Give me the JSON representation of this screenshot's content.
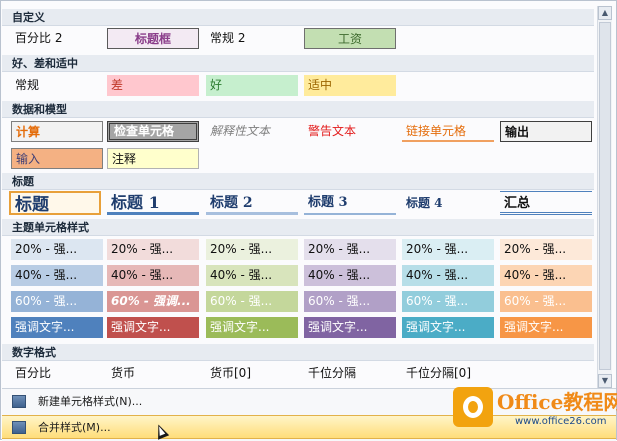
{
  "sections": {
    "custom": "自定义",
    "good_bad": "好、差和适中",
    "data_model": "数据和模型",
    "titles": "标题",
    "theme": "主题单元格样式",
    "number": "数字格式"
  },
  "custom": [
    "百分比 2",
    "标题框",
    "常规 2",
    "工资"
  ],
  "good_bad": [
    "常规",
    "差",
    "好",
    "适中"
  ],
  "data_model": [
    "计算",
    "检查单元格",
    "解释性文本",
    "警告文本",
    "链接单元格",
    "输出",
    "输入",
    "注释"
  ],
  "titles": [
    "标题",
    "标题 1",
    "标题 2",
    "标题 3",
    "标题 4",
    "汇总"
  ],
  "theme_rows": [
    [
      "20% - 强...",
      "20% - 强...",
      "20% - 强...",
      "20% - 强...",
      "20% - 强...",
      "20% - 强..."
    ],
    [
      "40% - 强...",
      "40% - 强...",
      "40% - 强...",
      "40% - 强...",
      "40% - 强...",
      "40% - 强..."
    ],
    [
      "60% - 强...",
      "60% - 强调...",
      "60% - 强...",
      "60% - 强...",
      "60% - 强...",
      "60% - 强..."
    ],
    [
      "强调文字...",
      "强调文字...",
      "强调文字...",
      "强调文字...",
      "强调文字...",
      "强调文字..."
    ]
  ],
  "number": [
    "百分比",
    "货币",
    "货币[0]",
    "千位分隔",
    "千位分隔[0]"
  ],
  "menu": {
    "new_style": "新建单元格样式(N)...",
    "merge_styles": "合并样式(M)..."
  },
  "watermark": {
    "title": "Office教程网",
    "url": "www.office26.com"
  },
  "scroll": {
    "up_icon": "▲",
    "down_icon": "▼"
  },
  "colors": {
    "accent1": "#4f81bd",
    "accent2": "#c0504d",
    "accent3": "#9bbb59",
    "accent4": "#8064a2",
    "accent5": "#4bacc6",
    "accent6": "#f79646"
  }
}
